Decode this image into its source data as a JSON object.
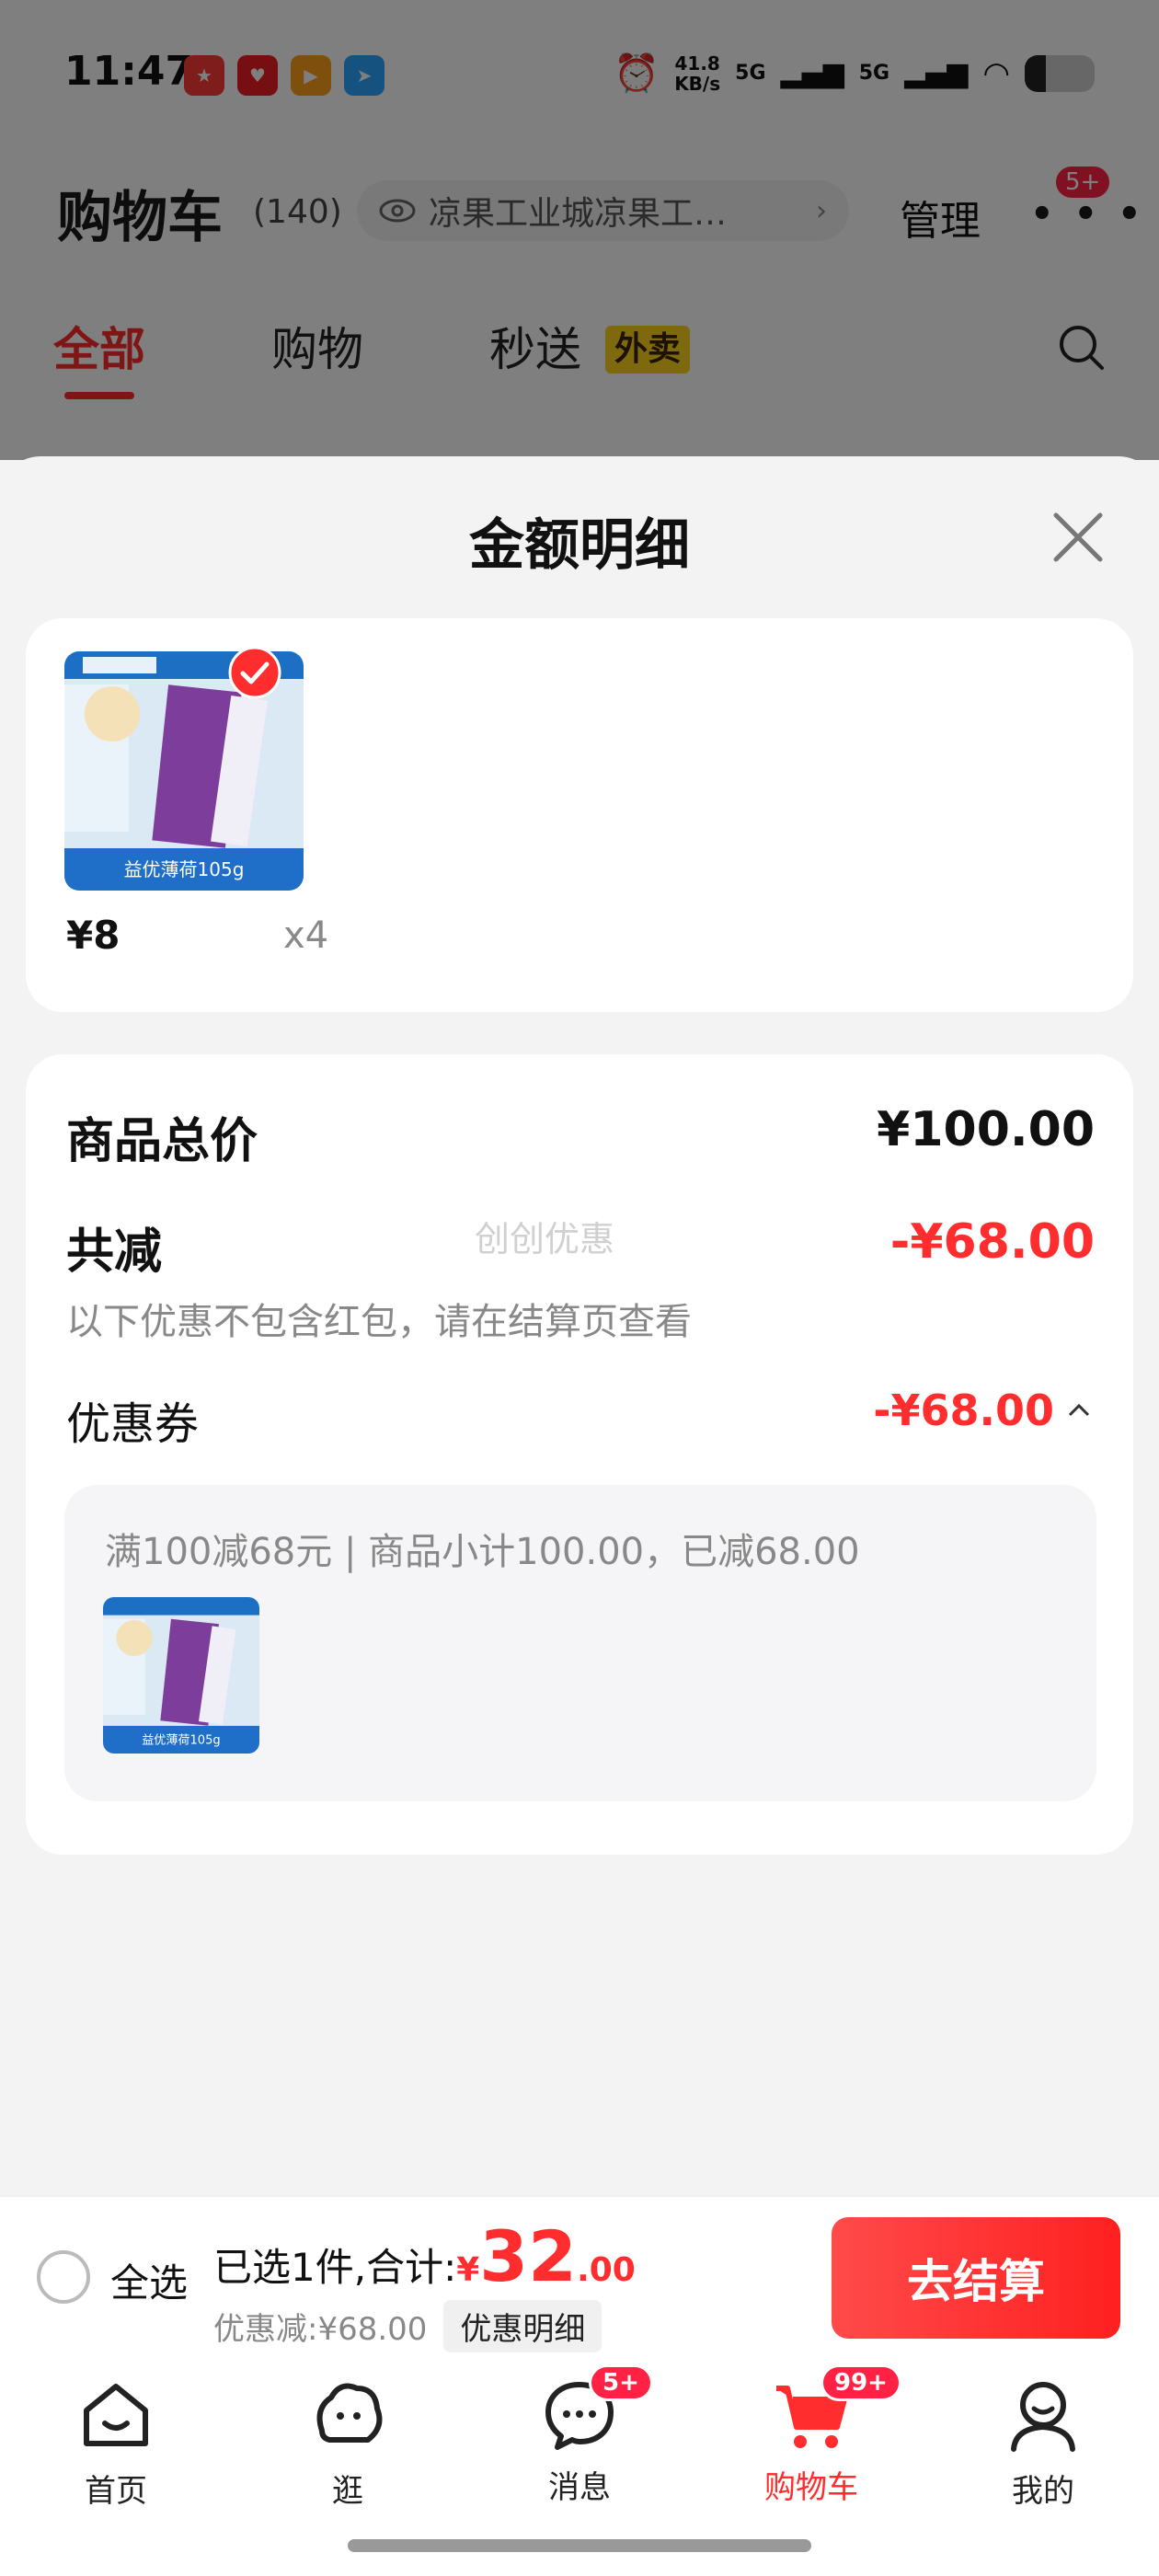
{
  "status_bar": {
    "time": "11:47",
    "net_speed_value": "41.8",
    "net_speed_unit": "KB/s",
    "signal_1": "5G",
    "signal_2": "5G"
  },
  "cart_header": {
    "title": "购物车",
    "count": "(140)",
    "address": "凉果工业城凉果工…",
    "manage_label": "管理",
    "more_badge": "5+"
  },
  "cart_tabs": [
    {
      "label": "全部"
    },
    {
      "label": "购物"
    },
    {
      "label": "秒送"
    }
  ],
  "takeout_tag": "外卖",
  "sheet": {
    "title": "金额明细",
    "product": {
      "price": "¥8",
      "qty": "x4",
      "thumb_caption": "益优薄荷105g"
    },
    "total_label": "商品总价",
    "total_value": "¥100.00",
    "reduce_label": "共减",
    "reduce_value": "-¥68.00",
    "reduce_note": "以下优惠不包含红包，请在结算页查看",
    "watermark": "创创优惠",
    "coupon_label": "优惠券",
    "coupon_value": "-¥68.00",
    "coupon_desc": "满100减68元 | 商品小计100.00，已减68.00"
  },
  "checkout": {
    "select_all_label": "全选",
    "summary_prefix": "已选1件,合计:",
    "currency": "¥",
    "amount_int": "32",
    "amount_dec": ".00",
    "discount_text": "优惠减:¥68.00",
    "detail_chip": "优惠明细",
    "button_label": "去结算"
  },
  "bottom_nav": [
    {
      "label": "首页",
      "icon": "home-icon"
    },
    {
      "label": "逛",
      "icon": "browse-icon"
    },
    {
      "label": "消息",
      "icon": "message-icon",
      "badge": "5+"
    },
    {
      "label": "购物车",
      "icon": "cart-icon",
      "badge": "99+"
    },
    {
      "label": "我的",
      "icon": "profile-icon"
    }
  ],
  "colors": {
    "accent": "#ff2d2d",
    "badge": "#ff2244",
    "tag": "#ffd21f"
  }
}
